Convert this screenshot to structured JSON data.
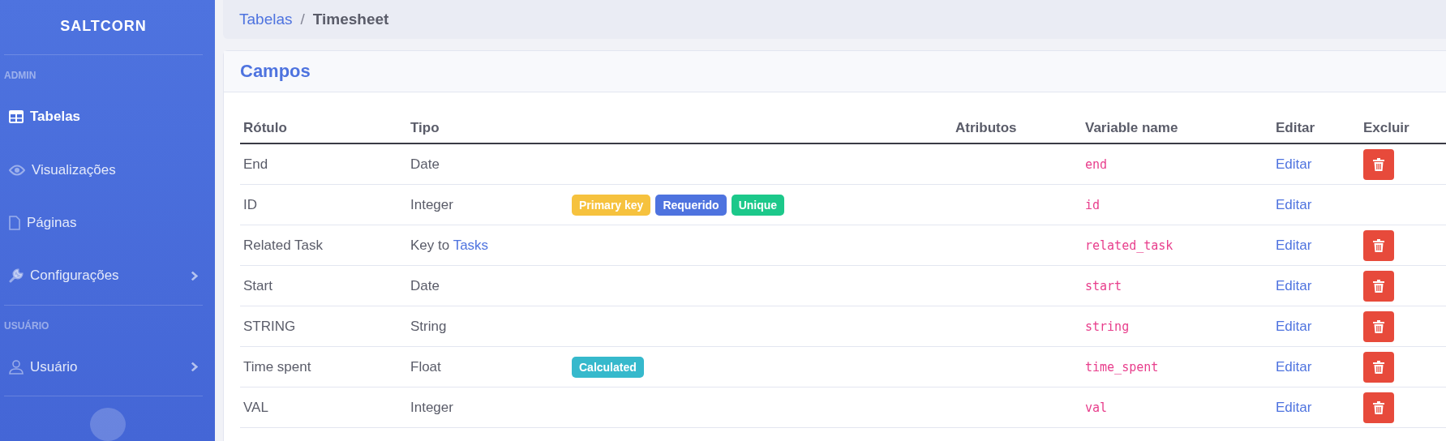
{
  "sidebar": {
    "brand": "SALTCORN",
    "sections": [
      {
        "heading": "ADMIN",
        "items": [
          {
            "label": "Tabelas",
            "selected": true,
            "has_submenu": false
          },
          {
            "label": "Visualizações",
            "selected": false,
            "has_submenu": false
          },
          {
            "label": "Páginas",
            "selected": false,
            "has_submenu": false
          },
          {
            "label": "Configurações",
            "selected": false,
            "has_submenu": true
          }
        ]
      },
      {
        "heading": "USUÁRIO",
        "items": [
          {
            "label": "Usuário",
            "selected": false,
            "has_submenu": true
          }
        ]
      }
    ]
  },
  "breadcrumb": {
    "link": "Tabelas",
    "separator": "/",
    "current": "Timesheet"
  },
  "card": {
    "title": "Campos",
    "columns": [
      {
        "label": "Rótulo"
      },
      {
        "label": "Tipo"
      },
      {
        "label": "Atributos"
      },
      {
        "label": "Variable name"
      },
      {
        "label": "Editar"
      },
      {
        "label": "Excluir"
      }
    ],
    "rows": [
      {
        "label": "End",
        "type": "Date",
        "badges": [],
        "variable": "end",
        "edit": "Editar",
        "deletable": true
      },
      {
        "label": "ID",
        "type": "Integer",
        "badges": [
          {
            "text": "Primary key",
            "color": "#f6c23e"
          },
          {
            "text": "Requerido",
            "color": "#4e73df"
          },
          {
            "text": "Unique",
            "color": "#1cc88a"
          }
        ],
        "variable": "id",
        "edit": "Editar",
        "deletable": false
      },
      {
        "label": "Related Task",
        "type": "Key to",
        "type_link": "Tasks",
        "badges": [],
        "variable": "related_task",
        "edit": "Editar",
        "deletable": true
      },
      {
        "label": "Start",
        "type": "Date",
        "badges": [],
        "variable": "start",
        "edit": "Editar",
        "deletable": true
      },
      {
        "label": "STRING",
        "type": "String",
        "badges": [],
        "variable": "string",
        "edit": "Editar",
        "deletable": true
      },
      {
        "label": "Time spent",
        "type": "Float",
        "badges": [
          {
            "text": "Calculated",
            "color": "#36b9cc"
          }
        ],
        "variable": "time_spent",
        "edit": "Editar",
        "deletable": true
      },
      {
        "label": "VAL",
        "type": "Integer",
        "badges": [],
        "variable": "val",
        "edit": "Editar",
        "deletable": true
      }
    ]
  }
}
